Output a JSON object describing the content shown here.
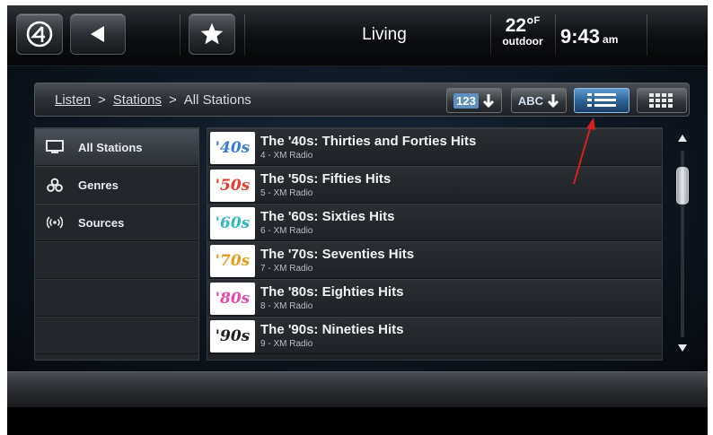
{
  "header": {
    "room": "Living",
    "temperature": "22°",
    "temperature_unit": "F",
    "temperature_label": "outdoor",
    "time": "9:43",
    "ampm": "am"
  },
  "breadcrumb": {
    "items": [
      "Listen",
      "Stations",
      "All Stations"
    ],
    "separator": ">"
  },
  "view_buttons": {
    "sort_numeric": "123",
    "sort_alpha": "ABC"
  },
  "sidebar": {
    "items": [
      {
        "label": "All Stations",
        "icon": "tv-icon",
        "active": true
      },
      {
        "label": "Genres",
        "icon": "genres-icon",
        "active": false
      },
      {
        "label": "Sources",
        "icon": "broadcast-icon",
        "active": false
      }
    ]
  },
  "stations": [
    {
      "logo": "'40s",
      "title": "The '40s: Thirties and Forties Hits",
      "subtitle": "4 - XM Radio",
      "color": "#3a7bd5"
    },
    {
      "logo": "'50s",
      "title": "The '50s: Fifties Hits",
      "subtitle": "5 - XM Radio",
      "color": "#e43b2c"
    },
    {
      "logo": "'60s",
      "title": "The '60s: Sixties Hits",
      "subtitle": "6 - XM Radio",
      "color": "#2fb8c4"
    },
    {
      "logo": "'70s",
      "title": "The '70s: Seventies Hits",
      "subtitle": "7 - XM Radio",
      "color": "#e89a1c"
    },
    {
      "logo": "'80s",
      "title": "The '80s: Eighties Hits",
      "subtitle": "8 - XM Radio",
      "color": "#e64aa8"
    },
    {
      "logo": "'90s",
      "title": "The '90s: Nineties Hits",
      "subtitle": "9 - XM Radio",
      "color": "#1f1f1f"
    }
  ],
  "colors": {
    "active_view": "#2a5f93",
    "annotation_arrow": "#d42020"
  }
}
